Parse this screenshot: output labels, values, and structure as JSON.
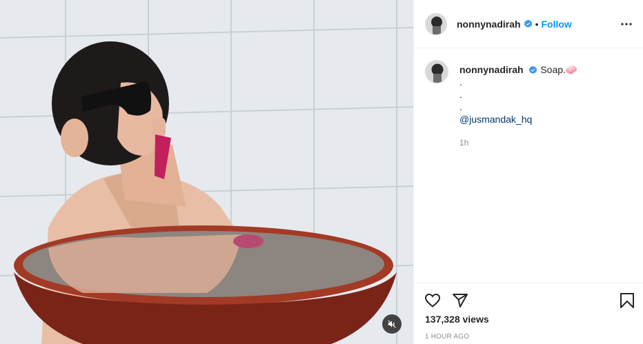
{
  "post": {
    "username": "nonnynadirah",
    "follow_label": "Follow",
    "separator": "•",
    "caption": "Soap.🧼",
    "caption_lines": [
      ".",
      ".",
      "."
    ],
    "mention": "@jusmandak_hq",
    "time_ago": "1h",
    "views": "137,328 views",
    "date": "1 HOUR AGO"
  },
  "icons": {
    "verified": "verified-badge-icon",
    "more": "more-options-icon",
    "like": "heart-icon",
    "share": "paper-plane-icon",
    "save": "bookmark-icon",
    "mute": "speaker-muted-icon"
  },
  "colors": {
    "accent": "#0095f6",
    "mention": "#00376b",
    "secondary_text": "#8e8e8e",
    "divider": "#efefef"
  }
}
